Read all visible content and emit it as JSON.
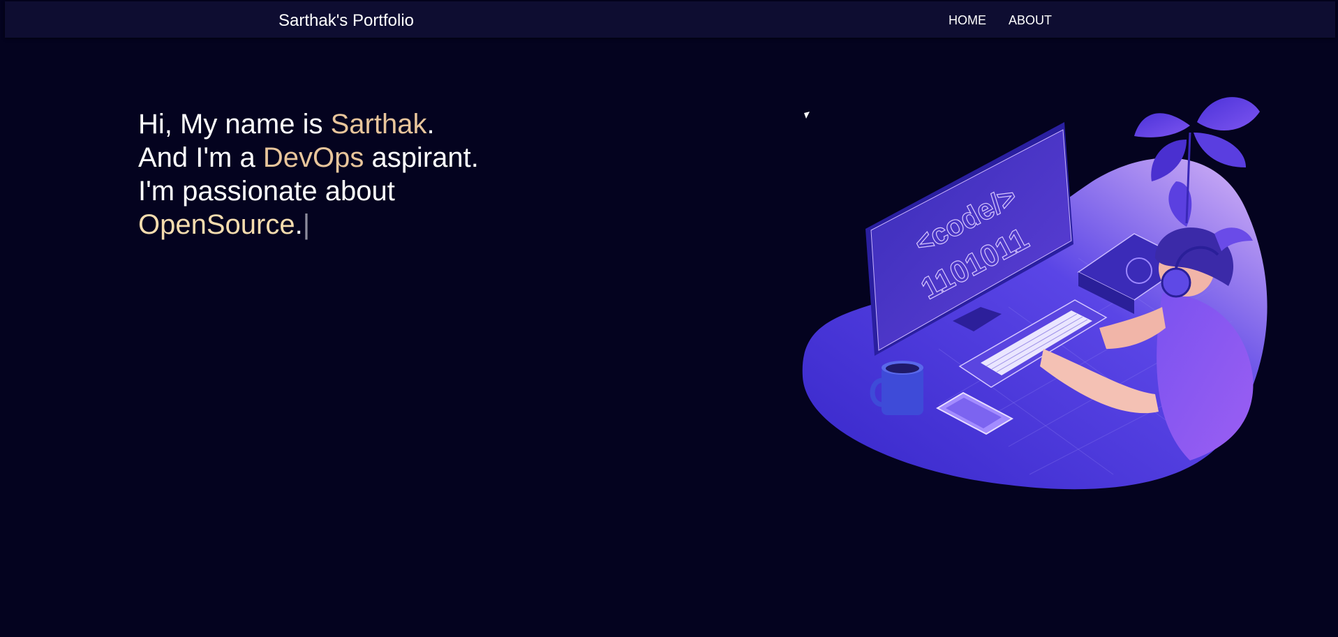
{
  "nav": {
    "brand": "Sarthak's Portfolio",
    "links": [
      {
        "label": "HOME"
      },
      {
        "label": "ABOUT"
      }
    ]
  },
  "intro": {
    "line1": {
      "prefix": "Hi, My name is ",
      "highlight": "Sarthak",
      "suffix": "."
    },
    "line2": {
      "prefix": "And I'm a ",
      "highlight": "DevOps",
      "suffix": " aspirant."
    },
    "line3": {
      "text": "I'm passionate about"
    },
    "line4": {
      "highlight": "OpenSource",
      "suffix": "."
    },
    "cursor": "|"
  },
  "hero_illustration": {
    "screen_code": "<code/>",
    "screen_binary": "1101011"
  },
  "colors": {
    "background": "#04031f",
    "navbar": "#0e0d31",
    "highlight": "#e8c59b",
    "accent_purple": "#5b3be0"
  }
}
